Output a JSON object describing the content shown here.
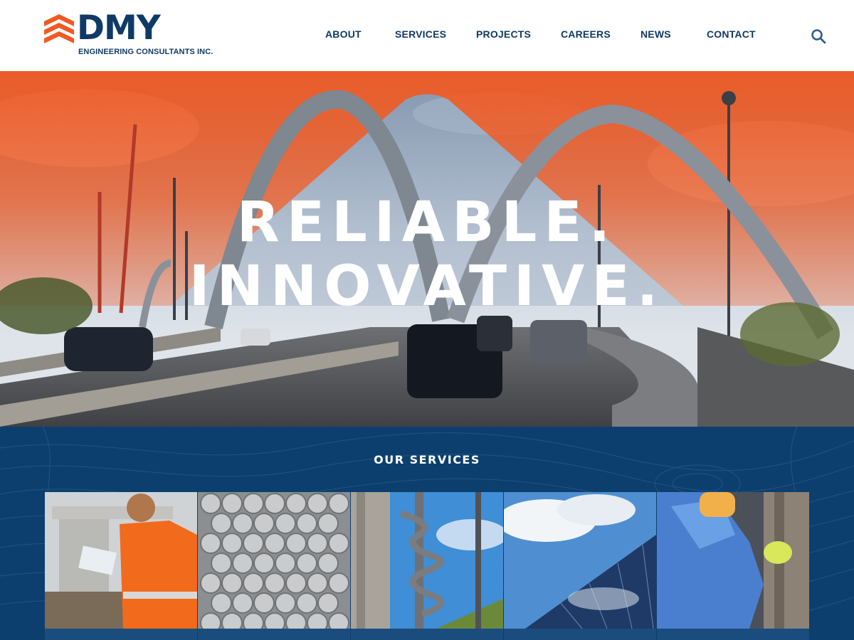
{
  "brand": {
    "name": "DMY",
    "subtitle": "ENGINEERING CONSULTANTS INC.",
    "colors": {
      "navy": "#0f3a66",
      "orange": "#f05a22",
      "services_bg": "#0d3f6e"
    }
  },
  "nav": {
    "items": [
      {
        "label": "ABOUT"
      },
      {
        "label": "SERVICES"
      },
      {
        "label": "PROJECTS"
      },
      {
        "label": "CAREERS"
      },
      {
        "label": "NEWS"
      },
      {
        "label": "CONTACT"
      }
    ],
    "search_icon": "search-icon"
  },
  "hero": {
    "line1": "RELIABLE.",
    "line2": "INNOVATIVE."
  },
  "services": {
    "title": "OUR SERVICES",
    "tiles": [
      {
        "icon": "engineer-photo"
      },
      {
        "icon": "steel-rods-photo"
      },
      {
        "icon": "auger-drill-photo"
      },
      {
        "icon": "glass-building-photo"
      },
      {
        "icon": "inspector-photo"
      }
    ]
  }
}
